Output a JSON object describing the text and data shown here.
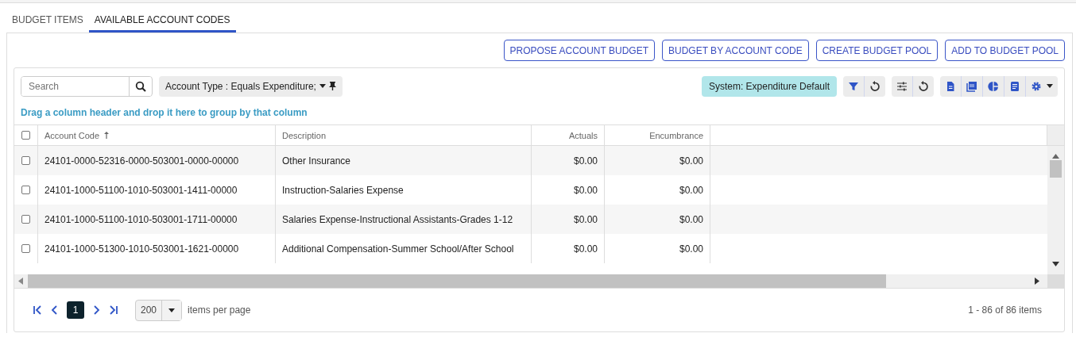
{
  "tabs": [
    {
      "label": "BUDGET ITEMS",
      "selected": false
    },
    {
      "label": "AVAILABLE ACCOUNT CODES",
      "selected": true
    }
  ],
  "actions": [
    "PROPOSE ACCOUNT BUDGET",
    "BUDGET BY ACCOUNT CODE",
    "CREATE BUDGET POOL",
    "ADD TO BUDGET POOL"
  ],
  "toolbar": {
    "search": {
      "placeholder": "Search"
    },
    "filter_chip": "Account Type : Equals Expenditure;",
    "view_label": "System: Expenditure Default"
  },
  "group_hint": "Drag a column header and drop it here to group by that column",
  "table": {
    "all_checked": false,
    "columns": [
      {
        "label": "Account Code",
        "sorted_ascending": true
      },
      {
        "label": "Description",
        "sorted_ascending": false
      },
      {
        "label": "Actuals",
        "sorted_ascending": false
      },
      {
        "label": "Encumbrance",
        "sorted_ascending": false
      }
    ],
    "rows": [
      {
        "checked": false,
        "cells": [
          "24101-0000-52316-0000-503001-0000-00000",
          "Other Insurance",
          "$0.00",
          "$0.00"
        ]
      },
      {
        "checked": false,
        "cells": [
          "24101-1000-51100-1010-503001-1411-00000",
          "Instruction-Salaries Expense",
          "$0.00",
          "$0.00"
        ]
      },
      {
        "checked": false,
        "cells": [
          "24101-1000-51100-1010-503001-1711-00000",
          "Salaries Expense-Instructional Assistants-Grades 1-12",
          "$0.00",
          "$0.00"
        ]
      },
      {
        "checked": false,
        "cells": [
          "24101-1000-51300-1010-503001-1621-00000",
          "Additional Compensation-Summer School/After School",
          "$0.00",
          "$0.00"
        ]
      }
    ]
  },
  "pager": {
    "pages": [
      {
        "label": "1",
        "selected": true
      }
    ],
    "page_size": "200",
    "page_size_label": "items per page",
    "summary": "1 - 86 of 86 items"
  }
}
